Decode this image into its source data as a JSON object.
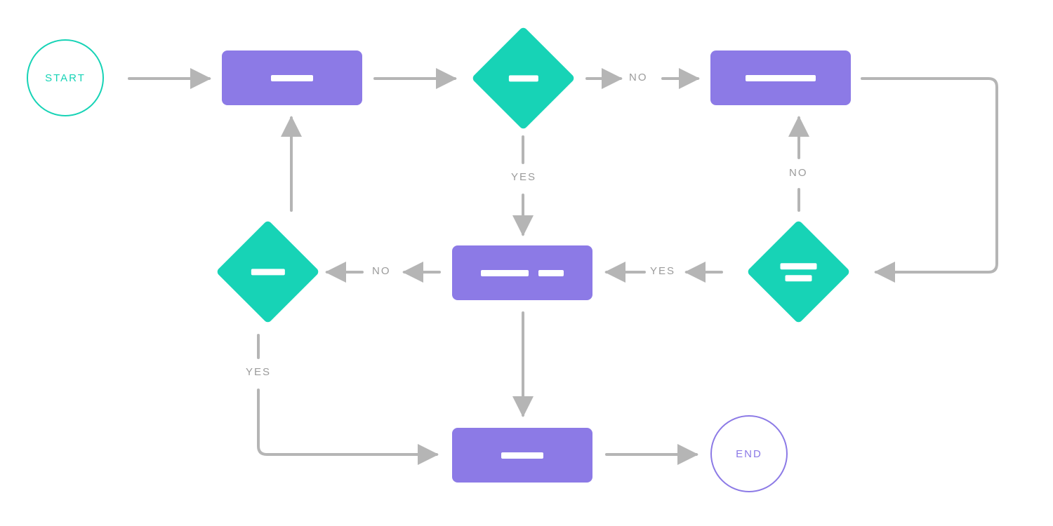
{
  "nodes": {
    "start": {
      "label": "START"
    },
    "end": {
      "label": "END"
    }
  },
  "edges": {
    "d1_no": "NO",
    "d1_yes": "YES",
    "d2_yes": "YES",
    "d2_no": "NO",
    "d3_no": "NO",
    "d3_yes": "YES"
  },
  "colors": {
    "teal": "#17d3b6",
    "purple": "#8c7ae6",
    "arrow": "#b5b5b5",
    "label": "#9b9b9b"
  },
  "chart_data": {
    "type": "flowchart",
    "nodes": [
      {
        "id": "start",
        "kind": "terminal",
        "label": "START"
      },
      {
        "id": "p1",
        "kind": "process"
      },
      {
        "id": "d1",
        "kind": "decision"
      },
      {
        "id": "p2",
        "kind": "process"
      },
      {
        "id": "d2",
        "kind": "decision"
      },
      {
        "id": "p3",
        "kind": "process"
      },
      {
        "id": "d3",
        "kind": "decision"
      },
      {
        "id": "p4",
        "kind": "process"
      },
      {
        "id": "end",
        "kind": "terminal",
        "label": "END"
      }
    ],
    "edges": [
      {
        "from": "start",
        "to": "p1",
        "label": null
      },
      {
        "from": "p1",
        "to": "d1",
        "label": null
      },
      {
        "from": "d1",
        "to": "p2",
        "label": "NO"
      },
      {
        "from": "d1",
        "to": "p3",
        "label": "YES"
      },
      {
        "from": "p2",
        "to": "d2",
        "label": null
      },
      {
        "from": "d2",
        "to": "p2",
        "label": "NO"
      },
      {
        "from": "d2",
        "to": "p3",
        "label": "YES"
      },
      {
        "from": "p3",
        "to": "d3",
        "label": "NO"
      },
      {
        "from": "p3",
        "to": "p4",
        "label": null
      },
      {
        "from": "d3",
        "to": "p1",
        "label": null
      },
      {
        "from": "d3",
        "to": "p4",
        "label": "YES"
      },
      {
        "from": "p4",
        "to": "end",
        "label": null
      }
    ]
  }
}
